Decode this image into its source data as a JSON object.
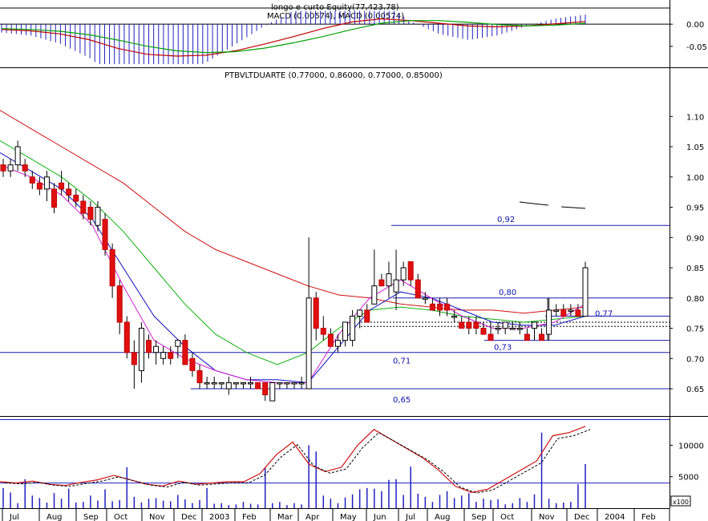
{
  "chart_data": [
    {
      "panel": "macd",
      "type": "line",
      "title": "longo e curto Equity(77,423.78)",
      "subtitle": "MACD (0.00574), MACD (0.00574)",
      "ylim": [
        -0.09,
        0.04
      ],
      "yticks": [
        0.0,
        -0.05
      ],
      "ytick_labels": [
        "0.00",
        "-0.05"
      ],
      "series": [
        {
          "name": "MACD",
          "values": [
            -0.012,
            -0.015,
            -0.022,
            -0.035,
            -0.055,
            -0.068,
            -0.072,
            -0.07,
            -0.06,
            -0.045,
            -0.028,
            -0.01,
            0.005,
            0.012,
            0.008,
            0.002,
            -0.004,
            -0.006,
            -0.004,
            0.001,
            0.006
          ]
        },
        {
          "name": "MACD signal",
          "values": [
            -0.01,
            -0.012,
            -0.016,
            -0.024,
            -0.036,
            -0.05,
            -0.06,
            -0.064,
            -0.062,
            -0.054,
            -0.042,
            -0.028,
            -0.012,
            0.002,
            0.008,
            0.008,
            0.004,
            -0.001,
            -0.004,
            -0.002,
            0.002
          ]
        }
      ]
    },
    {
      "panel": "price",
      "type": "candlestick",
      "title": "PTBVLTDUARTE (0.77000, 0.86000, 0.77000, 0.85000)",
      "ylim": [
        0.605,
        1.16
      ],
      "yticks": [
        1.1,
        1.05,
        1.0,
        0.95,
        0.9,
        0.85,
        0.8,
        0.75,
        0.7,
        0.65
      ],
      "ytick_labels": [
        "1.10",
        "1.05",
        "1.00",
        "0.95",
        "0.90",
        "0.85",
        "0.80",
        "0.75",
        "0.70",
        "0.65"
      ],
      "candles_ohlc": [
        [
          1.02,
          1.03,
          1.0,
          1.01
        ],
        [
          1.01,
          1.03,
          1.0,
          1.02
        ],
        [
          1.02,
          1.06,
          1.01,
          1.05
        ],
        [
          1.02,
          1.03,
          1.0,
          1.01
        ],
        [
          1.0,
          1.01,
          0.98,
          0.99
        ],
        [
          0.99,
          1.0,
          0.97,
          0.98
        ],
        [
          0.98,
          1.01,
          0.96,
          1.0
        ],
        [
          0.98,
          0.99,
          0.94,
          0.95
        ],
        [
          0.99,
          1.01,
          0.97,
          0.98
        ],
        [
          0.98,
          0.99,
          0.96,
          0.97
        ],
        [
          0.97,
          0.98,
          0.95,
          0.96
        ],
        [
          0.96,
          0.97,
          0.93,
          0.94
        ],
        [
          0.95,
          0.96,
          0.92,
          0.93
        ],
        [
          0.92,
          0.96,
          0.91,
          0.95
        ],
        [
          0.93,
          0.94,
          0.87,
          0.88
        ],
        [
          0.88,
          0.89,
          0.8,
          0.82
        ],
        [
          0.82,
          0.83,
          0.74,
          0.76
        ],
        [
          0.76,
          0.77,
          0.7,
          0.71
        ],
        [
          0.71,
          0.73,
          0.65,
          0.69
        ],
        [
          0.68,
          0.76,
          0.66,
          0.75
        ],
        [
          0.73,
          0.74,
          0.7,
          0.71
        ],
        [
          0.71,
          0.73,
          0.69,
          0.72
        ],
        [
          0.7,
          0.72,
          0.69,
          0.71
        ],
        [
          0.71,
          0.72,
          0.69,
          0.7
        ],
        [
          0.72,
          0.73,
          0.7,
          0.73
        ],
        [
          0.73,
          0.74,
          0.69,
          0.69
        ],
        [
          0.7,
          0.71,
          0.67,
          0.68
        ],
        [
          0.68,
          0.69,
          0.65,
          0.66
        ],
        [
          0.66,
          0.67,
          0.65,
          0.66
        ],
        [
          0.66,
          0.67,
          0.65,
          0.66
        ],
        [
          0.66,
          0.66,
          0.65,
          0.66
        ],
        [
          0.65,
          0.67,
          0.64,
          0.66
        ],
        [
          0.66,
          0.66,
          0.65,
          0.66
        ],
        [
          0.66,
          0.66,
          0.65,
          0.66
        ],
        [
          0.66,
          0.67,
          0.65,
          0.66
        ],
        [
          0.66,
          0.66,
          0.65,
          0.65
        ],
        [
          0.66,
          0.66,
          0.63,
          0.64
        ],
        [
          0.63,
          0.66,
          0.63,
          0.66
        ],
        [
          0.66,
          0.66,
          0.65,
          0.66
        ],
        [
          0.66,
          0.66,
          0.65,
          0.66
        ],
        [
          0.66,
          0.66,
          0.65,
          0.66
        ],
        [
          0.66,
          0.67,
          0.65,
          0.66
        ],
        [
          0.65,
          0.9,
          0.65,
          0.8
        ],
        [
          0.8,
          0.81,
          0.73,
          0.75
        ],
        [
          0.75,
          0.77,
          0.73,
          0.74
        ],
        [
          0.74,
          0.75,
          0.72,
          0.72
        ],
        [
          0.72,
          0.74,
          0.71,
          0.73
        ],
        [
          0.73,
          0.76,
          0.72,
          0.76
        ],
        [
          0.73,
          0.78,
          0.72,
          0.77
        ],
        [
          0.77,
          0.78,
          0.75,
          0.78
        ],
        [
          0.78,
          0.79,
          0.76,
          0.76
        ],
        [
          0.79,
          0.88,
          0.79,
          0.82
        ],
        [
          0.83,
          0.84,
          0.82,
          0.82
        ],
        [
          0.82,
          0.86,
          0.8,
          0.84
        ],
        [
          0.81,
          0.88,
          0.78,
          0.83
        ],
        [
          0.83,
          0.86,
          0.82,
          0.85
        ],
        [
          0.86,
          0.86,
          0.82,
          0.83
        ],
        [
          0.83,
          0.84,
          0.8,
          0.8
        ],
        [
          0.8,
          0.81,
          0.79,
          0.8
        ],
        [
          0.79,
          0.8,
          0.78,
          0.78
        ],
        [
          0.79,
          0.8,
          0.77,
          0.78
        ],
        [
          0.79,
          0.8,
          0.77,
          0.78
        ],
        [
          0.77,
          0.78,
          0.76,
          0.77
        ],
        [
          0.76,
          0.77,
          0.75,
          0.75
        ],
        [
          0.76,
          0.77,
          0.74,
          0.75
        ],
        [
          0.76,
          0.77,
          0.74,
          0.75
        ],
        [
          0.75,
          0.76,
          0.74,
          0.74
        ],
        [
          0.74,
          0.76,
          0.73,
          0.73
        ],
        [
          0.75,
          0.76,
          0.74,
          0.75
        ],
        [
          0.75,
          0.76,
          0.74,
          0.76
        ],
        [
          0.75,
          0.76,
          0.75,
          0.75
        ],
        [
          0.75,
          0.76,
          0.74,
          0.75
        ],
        [
          0.74,
          0.75,
          0.73,
          0.73
        ],
        [
          0.75,
          0.76,
          0.73,
          0.76
        ],
        [
          0.74,
          0.75,
          0.73,
          0.73
        ],
        [
          0.74,
          0.8,
          0.73,
          0.78
        ],
        [
          0.78,
          0.79,
          0.77,
          0.78
        ],
        [
          0.78,
          0.79,
          0.77,
          0.77
        ],
        [
          0.78,
          0.79,
          0.77,
          0.78
        ],
        [
          0.78,
          0.79,
          0.77,
          0.77
        ],
        [
          0.77,
          0.86,
          0.77,
          0.85
        ]
      ],
      "moving_averages": [
        {
          "name": "MA long (red)",
          "values": [
            1.11,
            1.08,
            1.05,
            1.02,
            0.99,
            0.95,
            0.91,
            0.88,
            0.86,
            0.84,
            0.82,
            0.805,
            0.8,
            0.79,
            0.785,
            0.78,
            0.78,
            0.775,
            0.78,
            0.785
          ]
        },
        {
          "name": "MA medium (green)",
          "values": [
            1.06,
            1.03,
            1.0,
            0.96,
            0.91,
            0.85,
            0.79,
            0.74,
            0.71,
            0.69,
            0.71,
            0.75,
            0.78,
            0.785,
            0.78,
            0.77,
            0.765,
            0.76,
            0.765,
            0.77
          ]
        },
        {
          "name": "MA short (blue)",
          "values": [
            1.04,
            1.01,
            0.98,
            0.93,
            0.85,
            0.77,
            0.72,
            0.68,
            0.665,
            0.665,
            0.66,
            0.72,
            0.78,
            0.81,
            0.8,
            0.78,
            0.76,
            0.755,
            0.755,
            0.77
          ]
        },
        {
          "name": "MA fast (magenta)",
          "values": [
            1.02,
            1.0,
            0.97,
            0.92,
            0.82,
            0.73,
            0.7,
            0.68,
            0.665,
            0.66,
            0.66,
            0.74,
            0.8,
            0.83,
            0.8,
            0.77,
            0.75,
            0.75,
            0.76,
            0.79
          ]
        }
      ],
      "levels": [
        {
          "value": 0.92,
          "label": "0,92"
        },
        {
          "value": 0.8,
          "label": "0,80"
        },
        {
          "value": 0.77,
          "label": "0,77"
        },
        {
          "value": 0.73,
          "label": "0,73"
        },
        {
          "value": 0.71,
          "label": "0,71"
        },
        {
          "value": 0.65,
          "label": "0,65"
        }
      ]
    },
    {
      "panel": "volume",
      "type": "bar",
      "unit_label": "x100",
      "ylim": [
        0,
        14000
      ],
      "yticks": [
        10000,
        5000
      ],
      "ytick_labels": [
        "10000",
        "5000"
      ],
      "x_tick_labels": [
        "Jul",
        "Aug",
        "Sep",
        "Oct",
        "Nov",
        "Dec",
        "2003",
        "Feb",
        "Mar",
        "Apr",
        "May",
        "Jun",
        "Jul",
        "Aug",
        "Sep",
        "Oct",
        "Nov",
        "Dec",
        "2004",
        "Feb"
      ],
      "volumes": [
        3200,
        2500,
        800,
        4600,
        2000,
        1600,
        900,
        2400,
        1500,
        3100,
        900,
        1000,
        2000,
        1200,
        3000,
        1100,
        1300,
        6500,
        1800,
        900,
        1500,
        1600,
        1200,
        1100,
        2100,
        1400,
        800,
        1300,
        3200,
        700,
        800,
        500,
        600,
        1000,
        700,
        600,
        6500,
        800,
        1000,
        500,
        800,
        600,
        10000,
        9000,
        2000,
        1500,
        800,
        1700,
        2200,
        3000,
        3200,
        3100,
        2700,
        4500,
        4600,
        2100,
        6600,
        2300,
        1800,
        1000,
        2100,
        2700,
        1600,
        2000,
        2400,
        1000,
        1500,
        1300,
        1400,
        600,
        800,
        1600,
        1000,
        2200,
        12000,
        1500,
        800,
        900,
        1000,
        3800,
        7000
      ],
      "oscillator": [
        4200,
        4000,
        4300,
        3800,
        3600,
        4100,
        4500,
        5200,
        4500,
        3800,
        3500,
        4300,
        3800,
        4000,
        4200,
        4200,
        5500,
        8500,
        10500,
        7000,
        5800,
        6500,
        10000,
        12500,
        11000,
        9500,
        8000,
        6000,
        3500,
        2500,
        3000,
        4500,
        6000,
        7500,
        11500,
        12000,
        13000
      ]
    }
  ]
}
